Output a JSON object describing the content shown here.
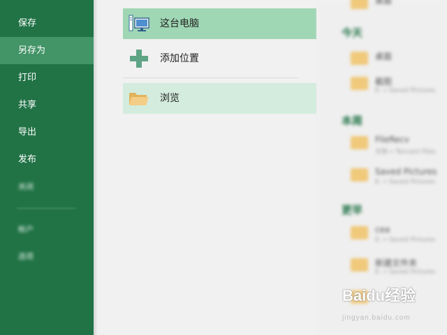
{
  "sidebar": {
    "items": [
      {
        "label": "保存"
      },
      {
        "label": "另存为"
      },
      {
        "label": "打印"
      },
      {
        "label": "共享"
      },
      {
        "label": "导出"
      },
      {
        "label": "发布"
      },
      {
        "label": "关闭"
      },
      {
        "label": "帐户"
      },
      {
        "label": "选项"
      }
    ],
    "active_index": 1,
    "colors": {
      "background": "#217346",
      "active": "#439467"
    }
  },
  "locations": [
    {
      "label": "这台电脑",
      "icon": "computer-icon",
      "state": "selected"
    },
    {
      "label": "添加位置",
      "icon": "plus-icon",
      "state": "normal"
    },
    {
      "label": "浏览",
      "icon": "folder-open-icon",
      "state": "hover"
    }
  ],
  "recent_panel": {
    "top_partial": {
      "name": "桌面"
    },
    "groups": [
      {
        "header": "今天",
        "items": [
          {
            "name": "桌面",
            "path": ""
          },
          {
            "name": "截图",
            "path": "E: » Saved Pictures"
          }
        ]
      },
      {
        "header": "本周",
        "items": [
          {
            "name": "FileRecv",
            "path": "文档 » Tencent Files"
          },
          {
            "name": "Saved Pictures",
            "path": "E: » Saved Pictures"
          }
        ]
      },
      {
        "header": "更早",
        "items": [
          {
            "name": "cea",
            "path": "E: » Saved Pictures"
          },
          {
            "name": "新建文件夹",
            "path": "E: » Saved Pictures"
          }
        ]
      }
    ]
  },
  "watermark": {
    "brand": "Baidu经验",
    "sub": "jingyan.baidu.com"
  }
}
